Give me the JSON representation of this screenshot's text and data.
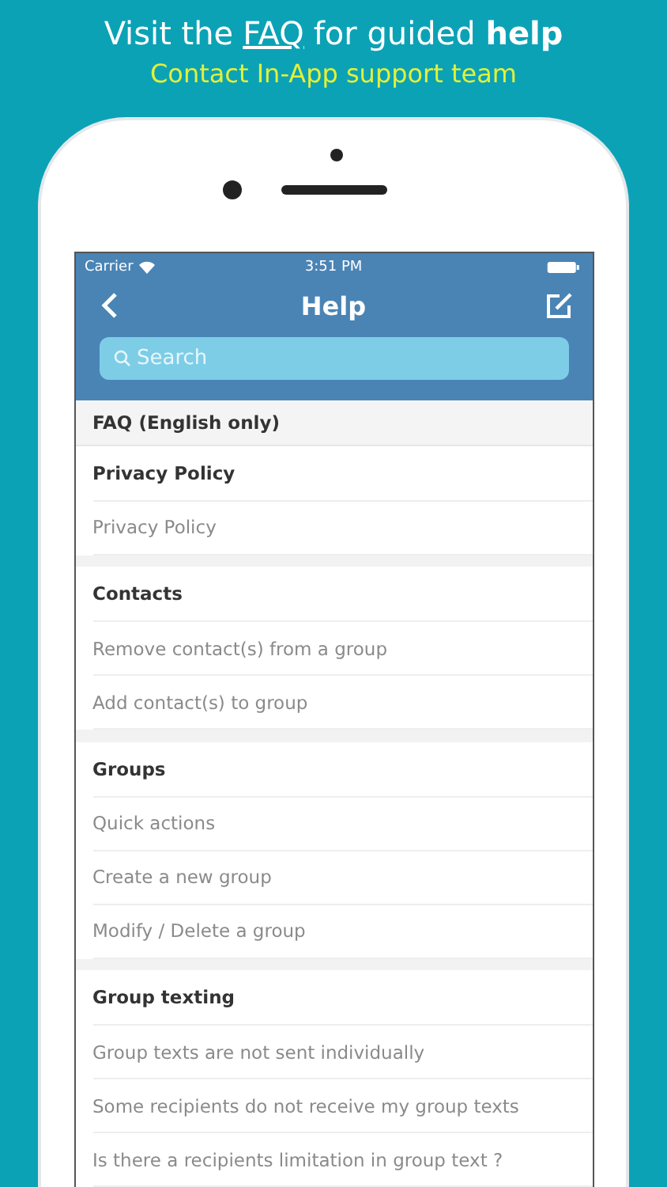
{
  "promo": {
    "headline_start": "Visit the",
    "headline_link": "FAQ",
    "headline_end": "for guided **help**",
    "tagline": "Contact In-App support team"
  },
  "status_bar": {
    "carrier": "Carrier",
    "time": "3:51 PM"
  },
  "nav": {
    "title": "Help"
  },
  "search": {
    "placeholder": "Search"
  },
  "banner": "FAQ (English only)",
  "sections": [
    {
      "title": "Privacy Policy",
      "items": [
        "Privacy Policy"
      ]
    },
    {
      "title": "Contacts",
      "items": [
        "Remove contact(s) from a group",
        "Add contact(s) to group"
      ]
    },
    {
      "title": "Groups",
      "items": [
        "Quick actions",
        "Create a new group",
        "Modify / Delete a group"
      ]
    },
    {
      "title": "Group texting",
      "items": [
        "Group texts are not sent individually",
        "Some recipients do not receive my group texts",
        "Is there a recipients limitation in group text ?"
      ]
    }
  ]
}
